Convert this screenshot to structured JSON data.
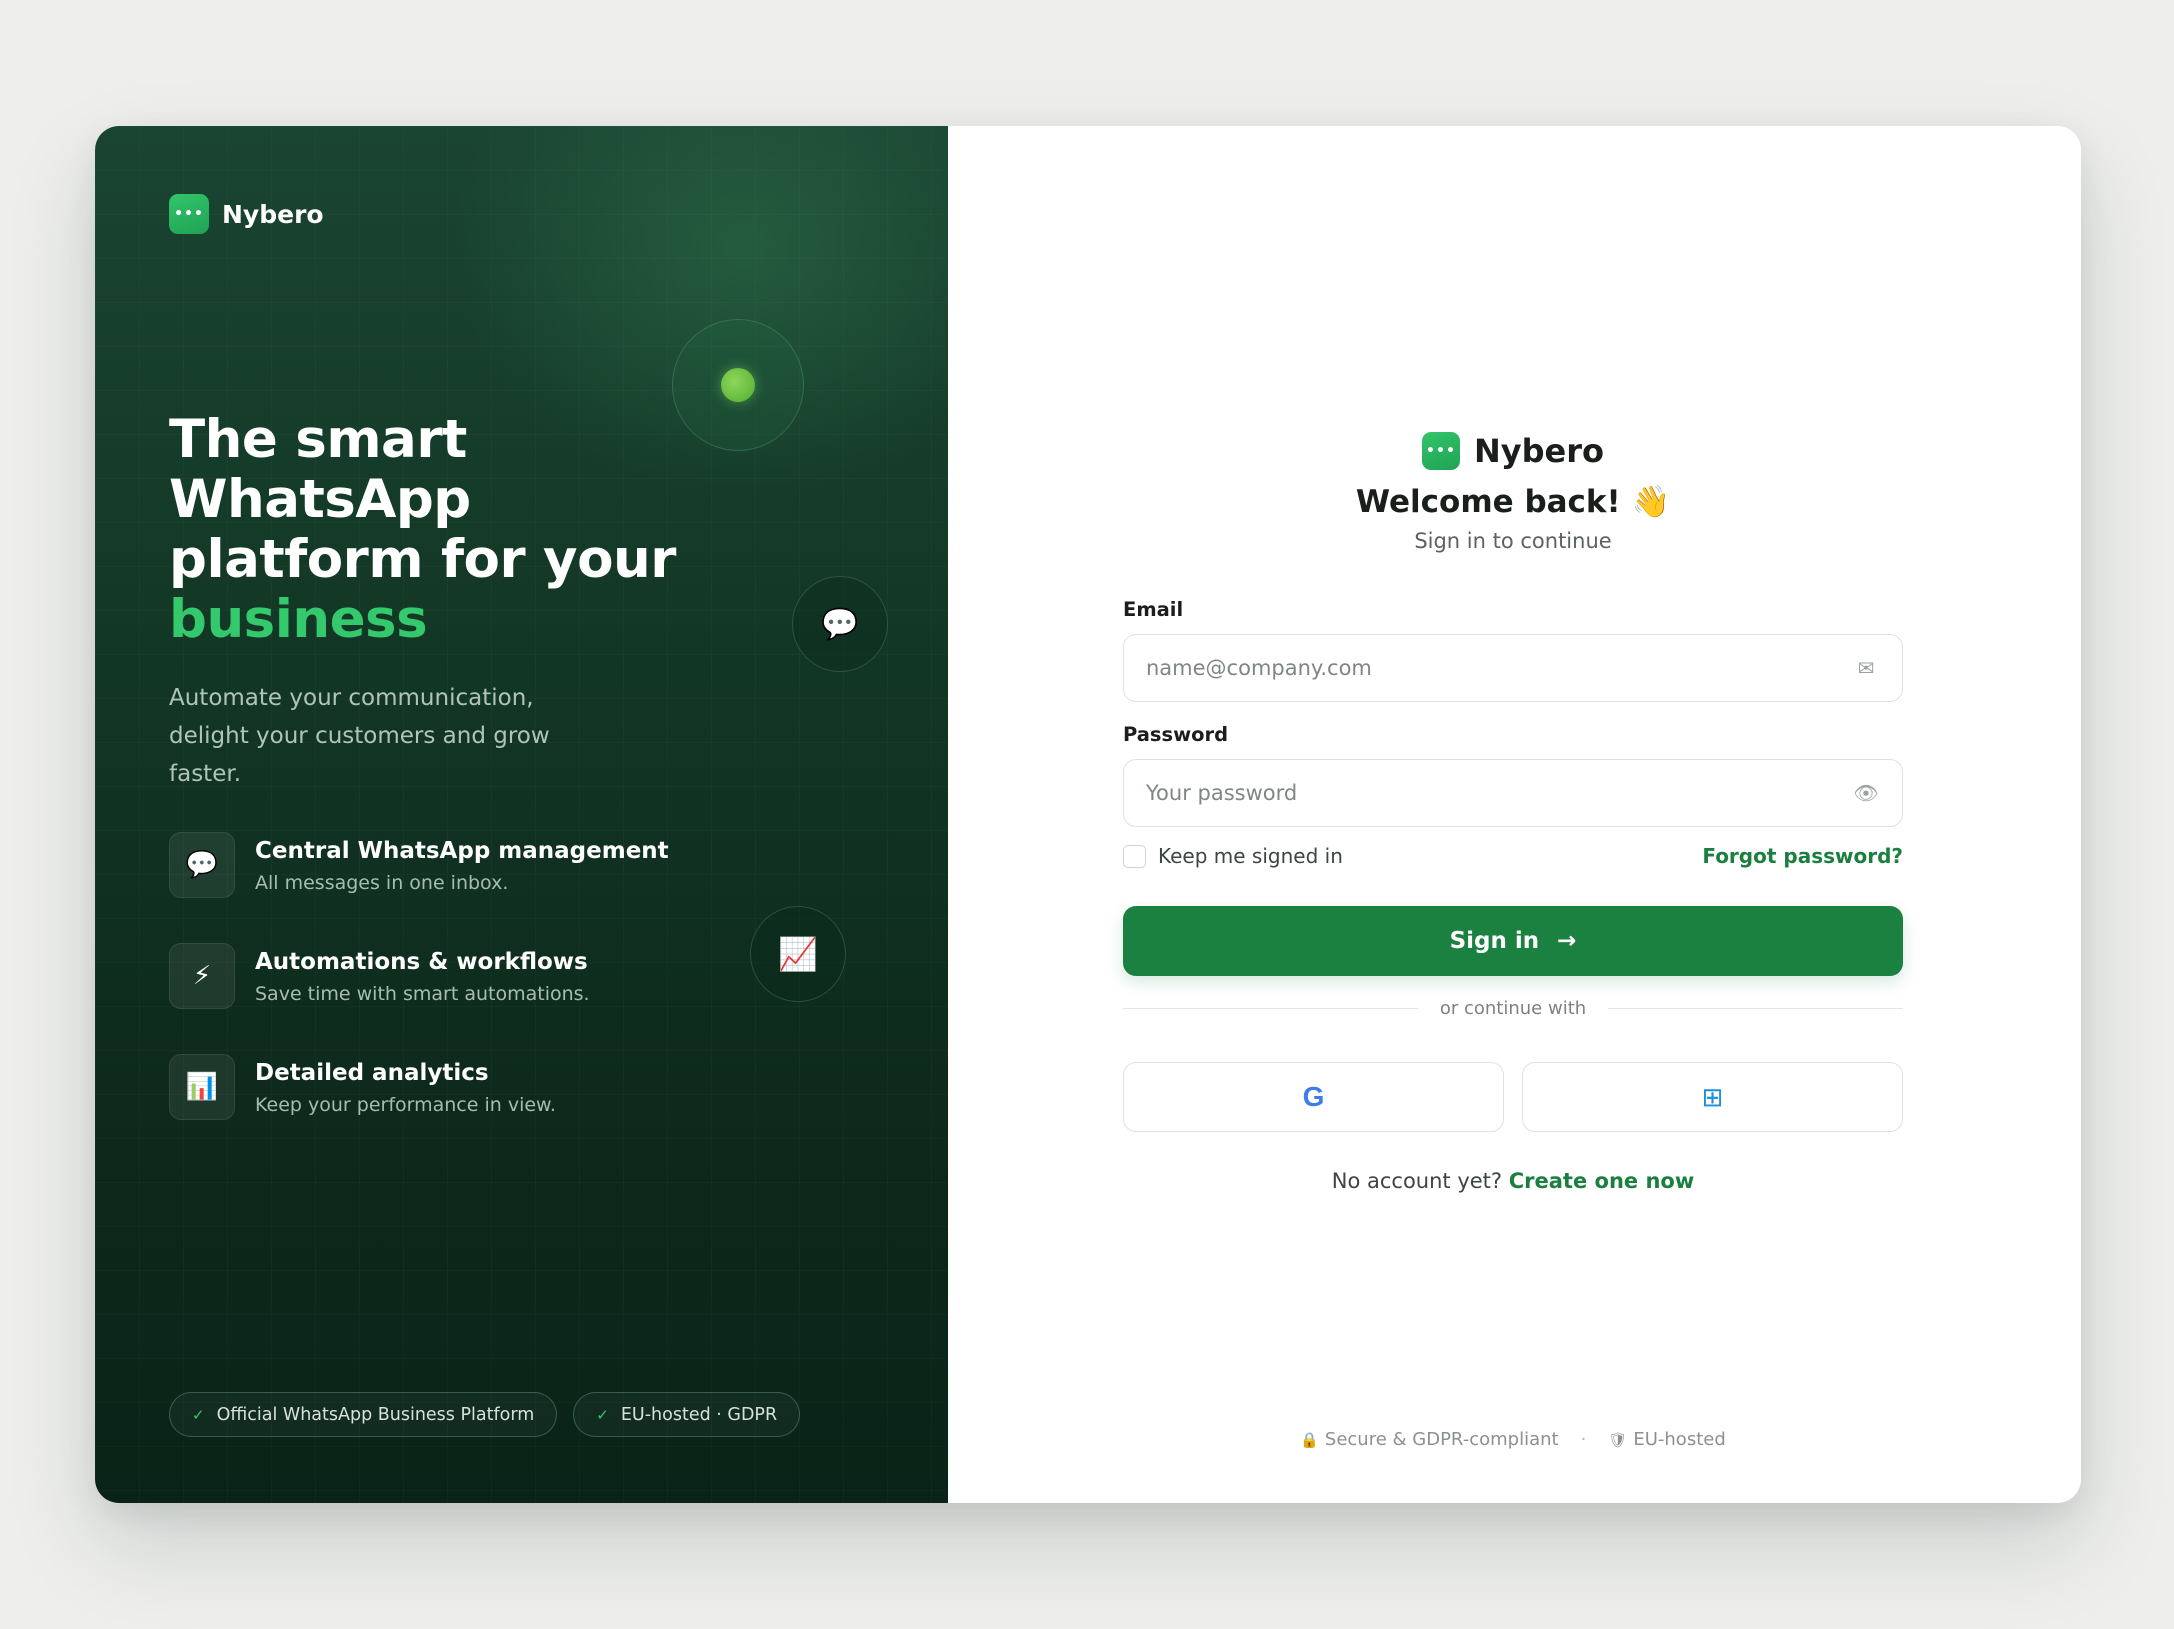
{
  "brand": {
    "name": "Nybero",
    "logo_glyph": "•••",
    "accent_color": "#1a8141"
  },
  "left": {
    "hero_line1": "The smart WhatsApp platform for your ",
    "hero_accent": "business",
    "subtitle": "Automate your communication, delight your customers and grow faster.",
    "features": [
      {
        "icon": "💬",
        "icon_name": "chat-bubble-icon",
        "title": "Central WhatsApp management",
        "desc": "All messages in one inbox."
      },
      {
        "icon": "⚡",
        "icon_name": "lightning-icon",
        "title": "Automations & workflows",
        "desc": "Save time with smart automations."
      },
      {
        "icon": "📊",
        "icon_name": "bar-chart-icon",
        "title": "Detailed analytics",
        "desc": "Keep your performance in view."
      }
    ],
    "floating_icons": {
      "chat": "💬",
      "trend": "📈"
    },
    "pills": [
      {
        "check": "✓",
        "label": "Official WhatsApp Business Platform"
      },
      {
        "check": "✓",
        "label": "EU-hosted · GDPR"
      }
    ]
  },
  "right": {
    "welcome": "Welcome back! 👋",
    "welcome_sub": "Sign in to continue",
    "email": {
      "label": "Email",
      "placeholder": "name@company.com",
      "value": "",
      "icon": "✉"
    },
    "password": {
      "label": "Password",
      "placeholder": "Your password",
      "value": "",
      "icon": "👁"
    },
    "remember_label": "Keep me signed in",
    "remember_checked": false,
    "forgot_label": "Forgot password?",
    "signin_label": "Sign in",
    "signin_arrow": "→",
    "divider_text": "or continue with",
    "social": {
      "google_glyph": "G",
      "microsoft_glyph": "⊞"
    },
    "signup_prompt": "No account yet?",
    "signup_link": "Create one now",
    "footer": {
      "secure_icon": "🔒",
      "secure_text": "Secure & GDPR-compliant",
      "separator": "·",
      "hosted_icon": "🛡",
      "hosted_text": "EU-hosted"
    }
  }
}
